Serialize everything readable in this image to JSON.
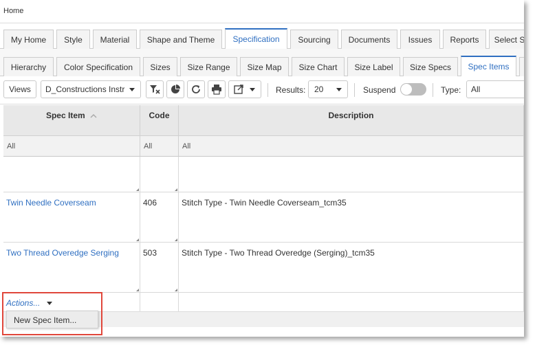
{
  "home_label": "Home",
  "main_tabs": [
    {
      "label": "My Home"
    },
    {
      "label": "Style"
    },
    {
      "label": "Material"
    },
    {
      "label": "Shape and Theme"
    },
    {
      "label": "Specification"
    },
    {
      "label": "Sourcing"
    },
    {
      "label": "Documents"
    },
    {
      "label": "Issues"
    },
    {
      "label": "Reports"
    },
    {
      "label": "Select S"
    }
  ],
  "sub_tabs": [
    {
      "label": "Hierarchy"
    },
    {
      "label": "Color Specification"
    },
    {
      "label": "Sizes"
    },
    {
      "label": "Size Range"
    },
    {
      "label": "Size Map"
    },
    {
      "label": "Size Chart"
    },
    {
      "label": "Size Label"
    },
    {
      "label": "Size Specs"
    },
    {
      "label": "Spec Items"
    }
  ],
  "toolbar": {
    "views_label": "Views",
    "view_select": "D_Constructions Instru",
    "results_label": "Results:",
    "results_value": "20",
    "suspend_label": "Suspend",
    "type_label": "Type:",
    "type_value": "All"
  },
  "grid": {
    "columns": [
      {
        "label": "Spec Item"
      },
      {
        "label": "Code"
      },
      {
        "label": "Description"
      }
    ],
    "filters": [
      "All",
      "All",
      "All"
    ],
    "rows": [
      {
        "spec_item": "",
        "code": "",
        "description": ""
      },
      {
        "spec_item": "Twin Needle Coverseam",
        "code": "406",
        "description": "Stitch Type - Twin Needle Coverseam_tcm35"
      },
      {
        "spec_item": "Two Thread Overedge Serging",
        "code": "503",
        "description": "Stitch Type - Two Thread Overedge (Serging)_tcm35"
      }
    ]
  },
  "actions_label": "Actions...",
  "menu": {
    "new_spec_item": "New Spec Item..."
  },
  "colors": {
    "accent": "#2f6fc1",
    "highlight": "#e0463a"
  }
}
